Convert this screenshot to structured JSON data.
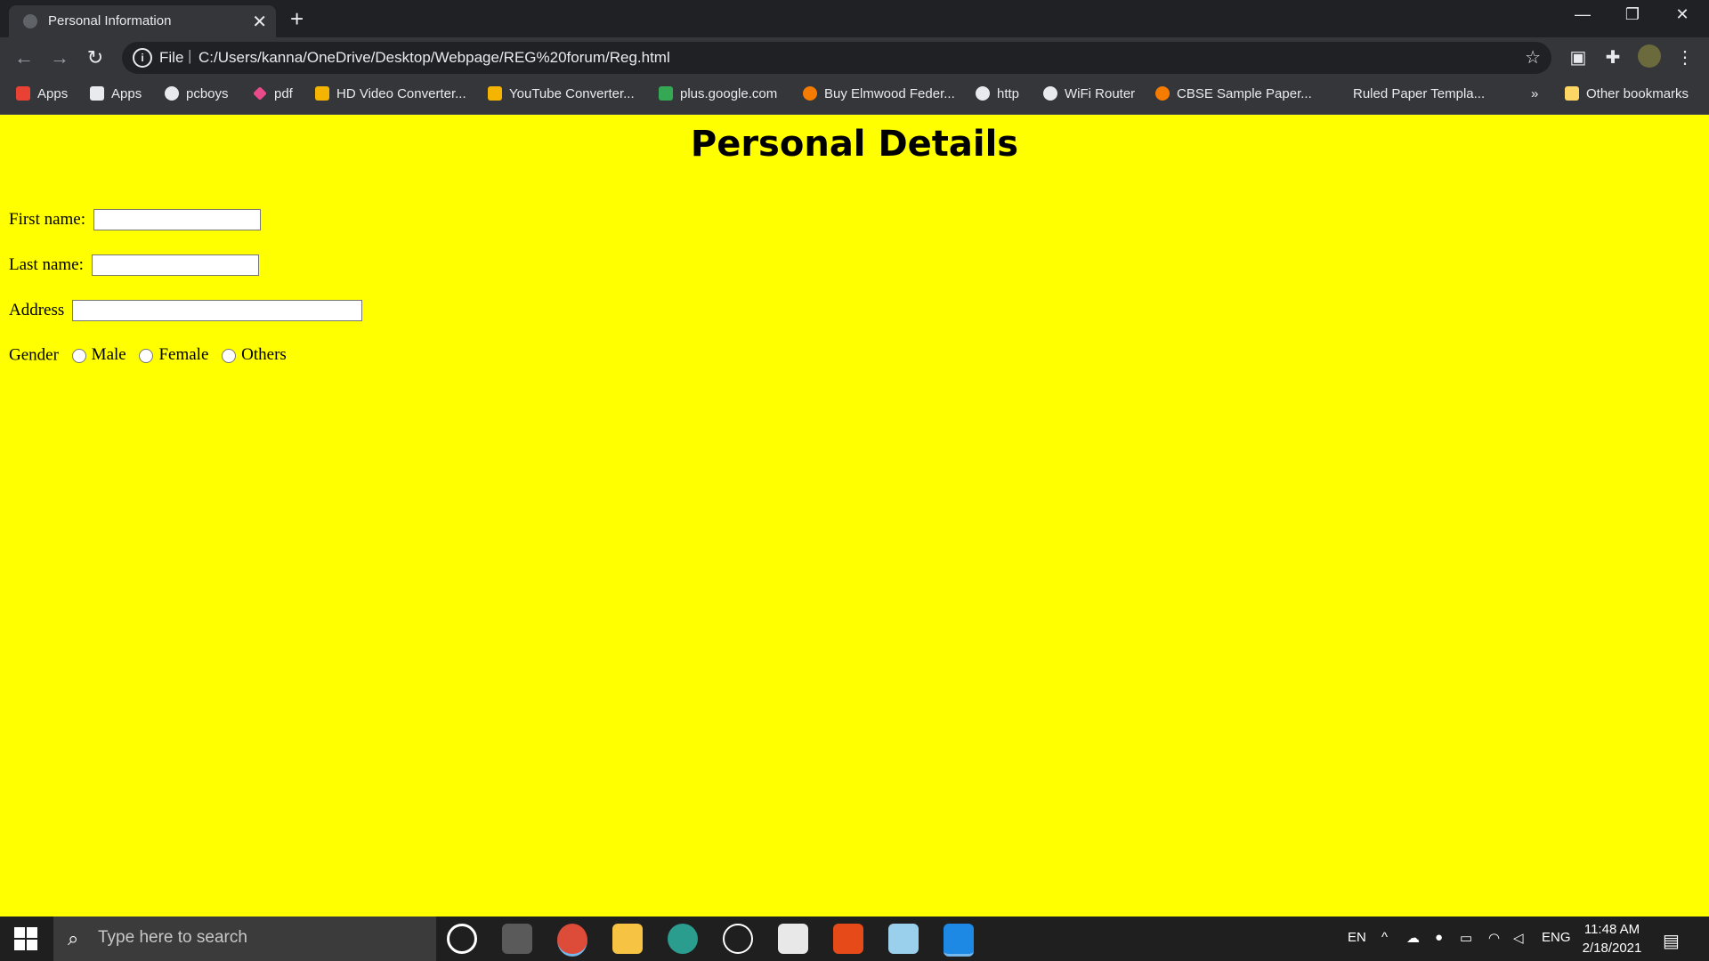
{
  "browser": {
    "tab_title": "Personal Information",
    "address_scheme": "File",
    "address_url": "C:/Users/kanna/OneDrive/Desktop/Webpage/REG%20forum/Reg.html",
    "more_bookmarks": "»",
    "bookmarks": [
      {
        "label": "Apps",
        "icon": "apps-grid-icon",
        "color": "#e94235"
      },
      {
        "label": "Apps",
        "icon": "apps-grid-icon",
        "color": "#e8eaed"
      },
      {
        "label": "pcboys",
        "icon": "globe-icon",
        "color": "#e8eaed"
      },
      {
        "label": "pdf",
        "icon": "diamond-icon",
        "color": "#e94b8a"
      },
      {
        "label": "HD Video Converter...",
        "icon": "video-converter-icon",
        "color": "#f4b400"
      },
      {
        "label": "YouTube Converter...",
        "icon": "video-converter-icon",
        "color": "#f4b400"
      },
      {
        "label": "plus.google.com",
        "icon": "google-plus-icon",
        "color": "#34a853"
      },
      {
        "label": "Buy Elmwood Feder...",
        "icon": "flower-icon",
        "color": "#f57c00"
      },
      {
        "label": "http",
        "icon": "globe-icon",
        "color": "#e8eaed"
      },
      {
        "label": "WiFi Router",
        "icon": "globe-icon",
        "color": "#e8eaed"
      },
      {
        "label": "CBSE Sample Paper...",
        "icon": "star-badge-icon",
        "color": "#f57c00"
      },
      {
        "label": "Ruled Paper Templa...",
        "icon": "document-icon",
        "color": "#35363a"
      }
    ],
    "other_bookmarks": "Other bookmarks"
  },
  "page": {
    "heading": "Personal Details",
    "first_name_label": "First name:",
    "last_name_label": "Last name:",
    "address_label": "Address",
    "gender_label": "Gender",
    "gender_options": [
      "Male",
      "Female",
      "Others"
    ],
    "background_color": "#ffff00"
  },
  "taskbar": {
    "search_placeholder": "Type here to search",
    "lang_short": "EN",
    "lang": "ENG",
    "time": "11:48 AM",
    "date": "2/18/2021"
  }
}
